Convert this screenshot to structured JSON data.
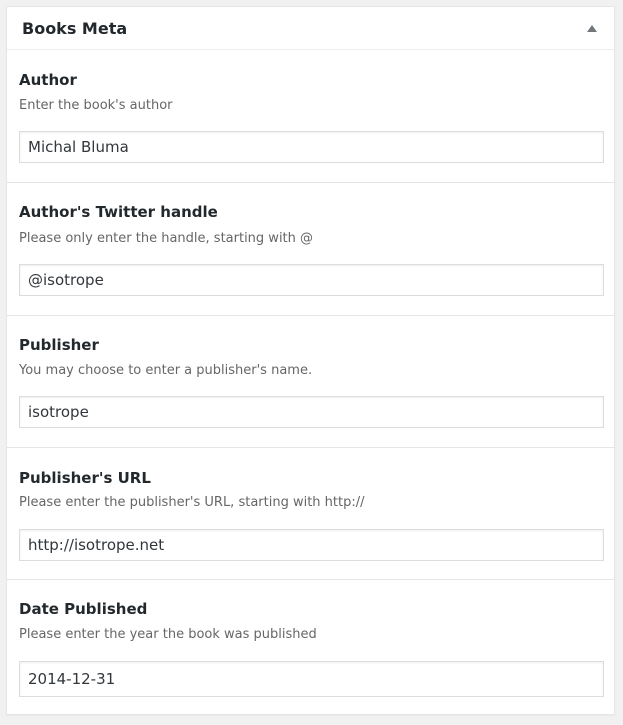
{
  "metabox": {
    "title": "Books Meta",
    "toggle_icon": "triangle-up-icon"
  },
  "fields": [
    {
      "label": "Author",
      "description": "Enter the book's author",
      "value": "Michal Bluma"
    },
    {
      "label": "Author's Twitter handle",
      "description": "Please only enter the handle, starting with @",
      "value": "@isotrope"
    },
    {
      "label": "Publisher",
      "description": "You may choose to enter a publisher's name.",
      "value": "isotrope"
    },
    {
      "label": "Publisher's URL",
      "description": "Please enter the publisher's URL, starting with http://",
      "value": "http://isotrope.net"
    },
    {
      "label": "Date Published",
      "description": "Please enter the year the book was published",
      "value": "2014-12-31"
    }
  ]
}
